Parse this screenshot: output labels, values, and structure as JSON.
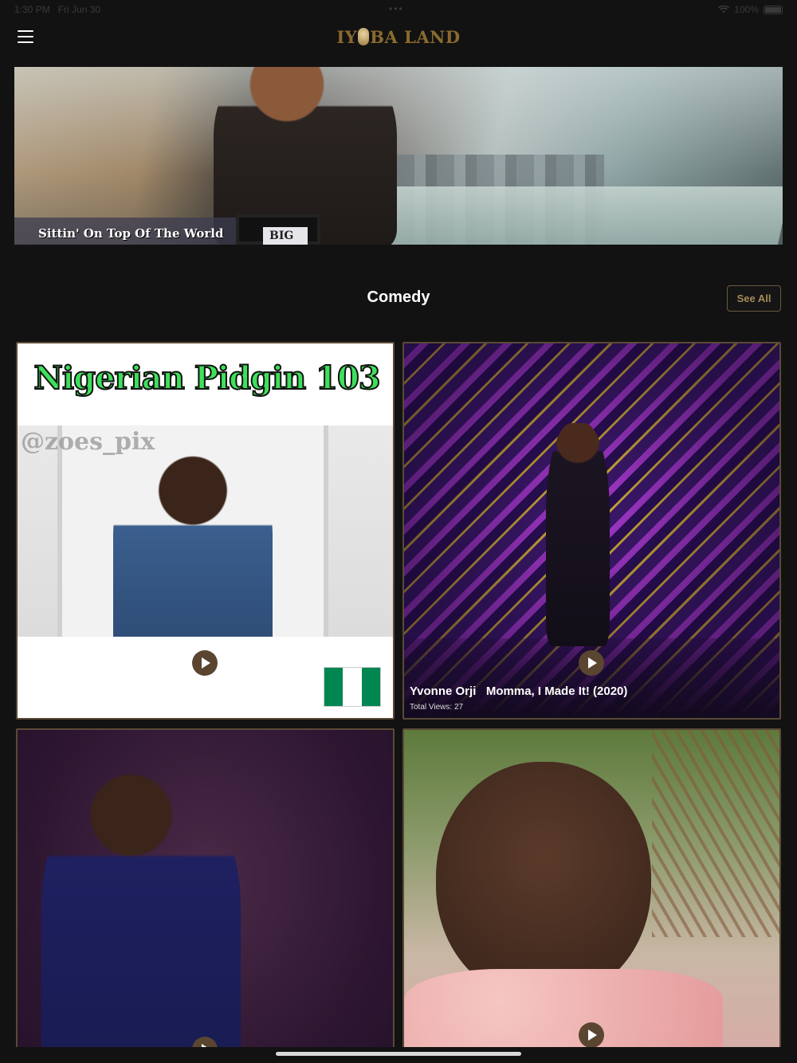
{
  "status_bar": {
    "time": "1:30 PM",
    "date": "Fri Jun 30",
    "dots": "•••",
    "battery_text": "100%",
    "wifi_icon": "wifi-icon",
    "battery_icon": "battery-icon"
  },
  "header": {
    "menu_icon": "hamburger-menu-icon",
    "logo_left": "IY",
    "logo_right": "BA LAND"
  },
  "hero": {
    "caption": "Sittin' On Top Of The World",
    "tag": "BIG"
  },
  "section": {
    "title": "Comedy",
    "see_all_label": "See All"
  },
  "cards": [
    {
      "banner": "Nigerian Pidgin 103",
      "watermark": "@zoes_pix",
      "play_icon": "play-icon"
    },
    {
      "title": "Yvonne Orji   Momma, I Made It! (2020)",
      "views": "Total Views: 27",
      "play_icon": "play-icon"
    },
    {
      "play_icon": "play-icon"
    },
    {
      "play_icon": "play-icon"
    }
  ],
  "colors": {
    "background": "#121212",
    "accent_gold": "#8a6a2e",
    "see_all_border": "#6a5a3e",
    "card_border": "#5a4a36",
    "play_button": "#5a4630",
    "flag_green": "#008751",
    "flag_white": "#ffffff"
  }
}
